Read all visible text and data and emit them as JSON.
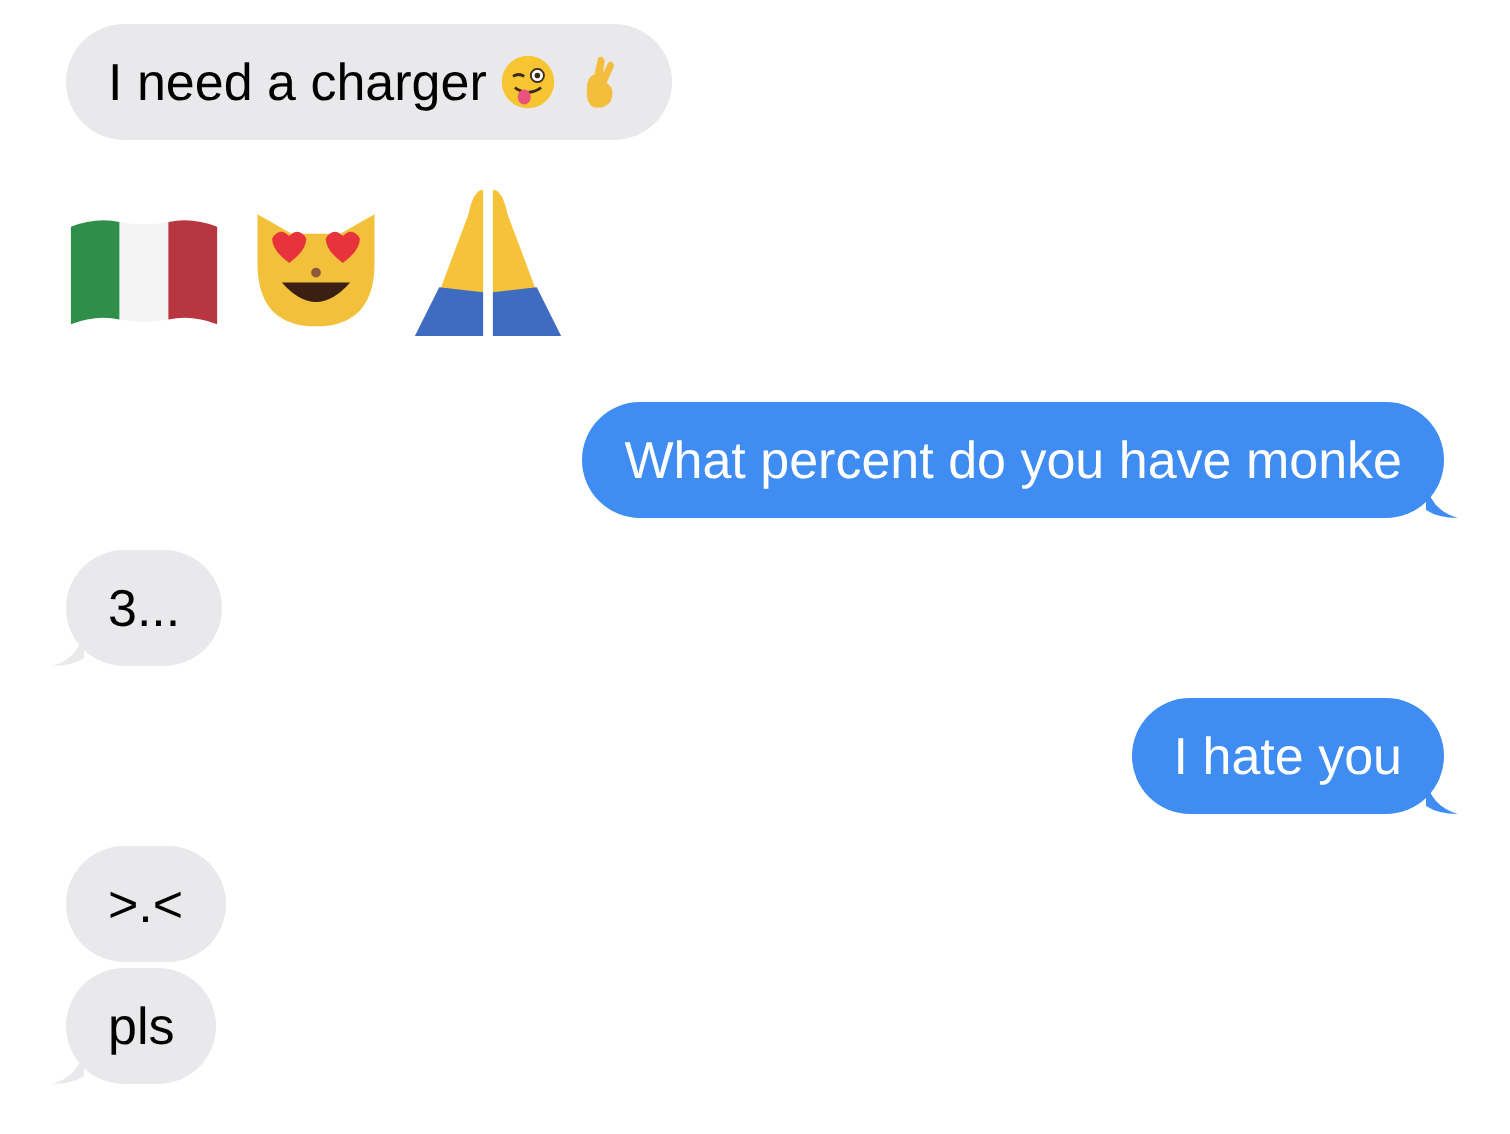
{
  "messages": [
    {
      "kind": "incoming",
      "text": "I need a charger",
      "emojis": [
        {
          "kind": "wink"
        },
        {
          "kind": "fingers"
        }
      ],
      "tail": false
    },
    {
      "kind": "emoji",
      "emojis": [
        {
          "kind": "flag"
        },
        {
          "kind": "cat"
        },
        {
          "kind": "prayer"
        }
      ]
    },
    {
      "kind": "outgoing",
      "text": "What percent do you have monke",
      "tail": true
    },
    {
      "kind": "incoming",
      "text": "3...",
      "tail": true
    },
    {
      "kind": "outgoing",
      "text": "I hate you",
      "tail": true
    },
    {
      "kind": "incoming",
      "text": ">.<",
      "tail": false
    },
    {
      "kind": "incoming",
      "text": "pls",
      "tail": true
    }
  ]
}
